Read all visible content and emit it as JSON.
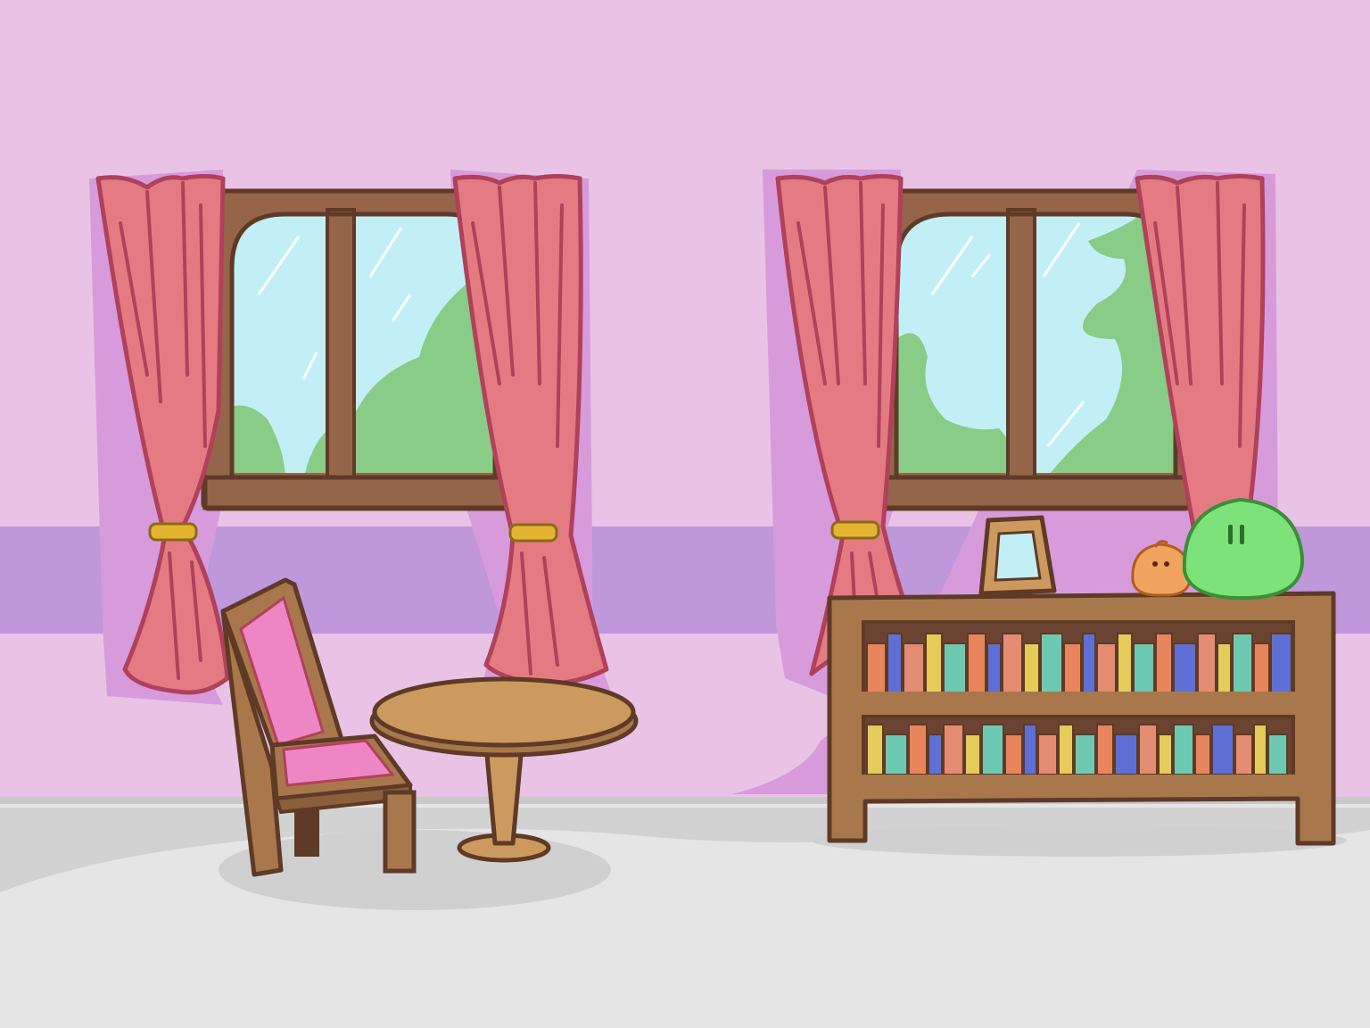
{
  "scene": {
    "type": "game-background",
    "setting": "indoor room",
    "objects": [
      "left-window",
      "left-window-curtain-left",
      "left-window-curtain-right",
      "right-window",
      "right-window-curtain-left",
      "right-window-curtain-right",
      "wooden-chair",
      "round-table",
      "bookshelf",
      "picture-frame",
      "orange-blob-creature",
      "green-blob-creature"
    ]
  },
  "colors": {
    "wall": "#e8c3e5",
    "wall_stripe": "#bf97db",
    "curtain_shadow": "#d79bdc",
    "curtain": "#e57b82",
    "curtain_outline": "#b0415a",
    "tieback": "#e4b430",
    "window_frame": "#95654a",
    "window_outline": "#5e3a27",
    "sky": "#c2eff5",
    "foliage": "#88cc88",
    "floor": "#e5e5e5",
    "floor_shadow": "#d0d0d0",
    "wood": "#a8784c",
    "wood_top": "#cc9a5f",
    "chair_seat": "#ee86c5",
    "slime_green": "#7ee27a",
    "slime_orange": "#f0a45f",
    "book_colors": [
      "#6ec9b3",
      "#5e6fd6",
      "#e5cb59",
      "#e8855c",
      "#e38c72"
    ]
  }
}
